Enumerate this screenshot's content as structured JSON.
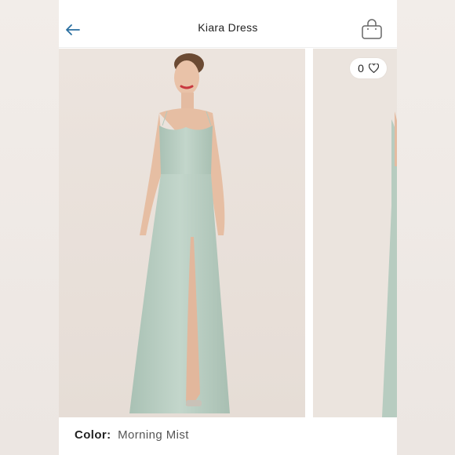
{
  "header": {
    "title": "Kiara Dress"
  },
  "icons": {
    "back": "arrow-left-icon",
    "bag": "shopping-bag-icon",
    "heart": "heart-icon"
  },
  "like": {
    "count": "0"
  },
  "color": {
    "label": "Color:",
    "value": "Morning Mist"
  },
  "colors": {
    "accent": "#2a6fa0",
    "dress": "#b9cfc3",
    "photo_bg": "#ebe4de"
  }
}
